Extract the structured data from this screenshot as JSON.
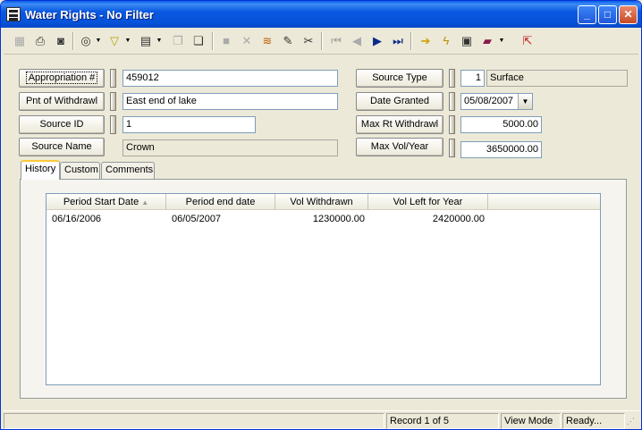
{
  "window": {
    "title": "Water Rights - No Filter",
    "minimize": "_",
    "maximize": "□",
    "close": "✕"
  },
  "toolbar": {
    "icons": [
      "table-icon",
      "print-icon",
      "print-preview-icon",
      "binoculars-icon",
      "filter-icon",
      "form-icon",
      "copy-icon",
      "paste-icon",
      "save-icon",
      "delete-icon",
      "stack-icon",
      "pencil-icon",
      "scissors-icon",
      "first-record-icon",
      "prev-record-icon",
      "next-record-icon",
      "last-record-icon",
      "arrow-right-icon",
      "lightning-icon",
      "report-icon",
      "book-icon",
      "exit-icon"
    ]
  },
  "form": {
    "appropriation_label": "Appropriation #",
    "appropriation_value": "459012",
    "pnt_withdrawl_label": "Pnt of Withdrawl",
    "pnt_withdrawl_value": "East end of lake",
    "source_id_label": "Source ID",
    "source_id_value": "1",
    "source_name_label": "Source Name",
    "source_name_value": "Crown",
    "source_type_label": "Source Type",
    "source_type_code": "1",
    "source_type_value": "Surface",
    "date_granted_label": "Date Granted",
    "date_granted_value": "05/08/2007",
    "max_rt_label": "Max Rt Withdrawl",
    "max_rt_value": "5000.00",
    "max_vol_label": "Max Vol/Year",
    "max_vol_value": "3650000.00"
  },
  "tabs": [
    {
      "label": "History"
    },
    {
      "label": "Custom"
    },
    {
      "label": "Comments"
    }
  ],
  "history": {
    "columns": [
      "Period Start Date",
      "Period end date",
      "Vol Withdrawn",
      "Vol Left for Year"
    ],
    "rows": [
      [
        "06/16/2006",
        "06/05/2007",
        "1230000.00",
        "2420000.00"
      ]
    ]
  },
  "status": {
    "record": "Record 1 of 5",
    "mode": "View Mode",
    "state": "Ready..."
  }
}
